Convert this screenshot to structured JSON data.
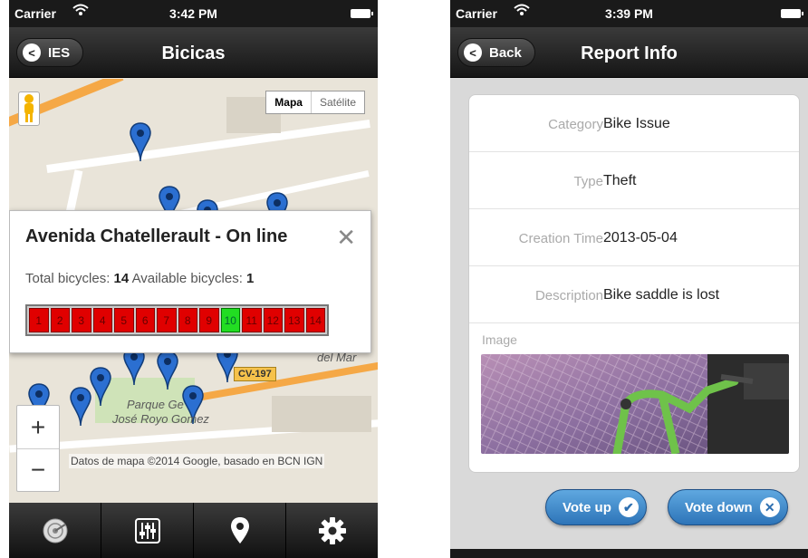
{
  "left": {
    "status": {
      "carrier": "Carrier",
      "time": "3:42 PM"
    },
    "nav": {
      "back_label": "IES",
      "title": "Bicicas"
    },
    "map": {
      "type_active": "Mapa",
      "type_inactive": "Satélite",
      "road_label": "CV-197",
      "sea_label": "del Mar",
      "park_label_1": "Parque Ge",
      "park_label_2": "José Royo Gomez",
      "attribution": "Datos de mapa ©2014 Google, basado en BCN IGN",
      "zoom_in": "+",
      "zoom_out": "−"
    },
    "popup": {
      "title": "Avenida Chatellerault - On line",
      "close": "✕",
      "total_label": "Total bicycles:",
      "total_value": "14",
      "available_label": "Available bicycles:",
      "available_value": "1",
      "slots": [
        "1",
        "2",
        "3",
        "4",
        "5",
        "6",
        "7",
        "8",
        "9",
        "10",
        "11",
        "12",
        "13",
        "14"
      ],
      "available_slot": "10"
    },
    "tabs": [
      "radar-icon",
      "equalizer-icon",
      "location-pin-icon",
      "gear-icon"
    ]
  },
  "right": {
    "status": {
      "carrier": "Carrier",
      "time": "3:39 PM"
    },
    "nav": {
      "back_label": "Back",
      "title": "Report Info"
    },
    "fields": [
      {
        "label": "Category",
        "value": "Bike Issue"
      },
      {
        "label": "Type",
        "value": "Theft"
      },
      {
        "label": "Creation Time",
        "value": "2013-05-04"
      },
      {
        "label": "Description",
        "value": "Bike saddle is lost"
      }
    ],
    "image_label": "Image",
    "vote_up": "Vote up",
    "vote_down": "Vote down"
  }
}
